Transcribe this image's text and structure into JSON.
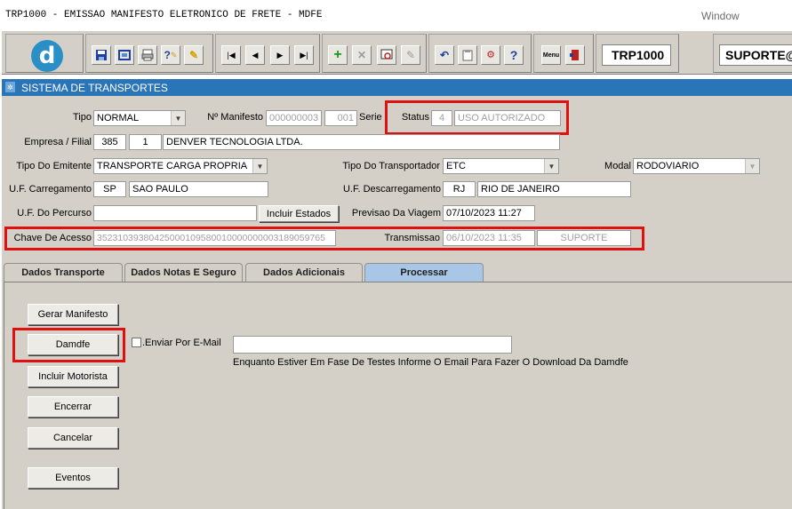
{
  "window": {
    "title": "TRP1000 - EMISSAO MANIFESTO ELETRONICO DE FRETE - MDFE",
    "menu": "Window"
  },
  "toolbar": {
    "logo_letter": "d",
    "buttons": [
      "save-icon",
      "preview-icon",
      "print-icon",
      "query-icon",
      "execute-icon",
      "first-icon",
      "previous-icon",
      "next-icon",
      "last-icon",
      "insert-icon",
      "delete-icon",
      "search-icon",
      "clear-icon",
      "undo-icon",
      "paste-icon",
      "settings-icon",
      "help-icon",
      "menu-icon",
      "exit-icon"
    ],
    "menu_label": "Menu",
    "program_code": "TRP1000",
    "user": "SUPORTE@"
  },
  "section": {
    "title": "SISTEMA DE TRANSPORTES"
  },
  "form": {
    "tipo_label": "Tipo",
    "tipo_value": "NORMAL",
    "manifesto_label": "Nº Manifesto",
    "manifesto_value": "000000003",
    "serie_number": "001",
    "serie_label": "Serie",
    "status_label": "Status",
    "status_code": "4",
    "status_desc": "USO AUTORIZADO",
    "empresa_label": "Empresa / Filial",
    "empresa_code": "385",
    "filial_code": "1",
    "empresa_name": "DENVER TECNOLOGIA LTDA.",
    "emitente_label": "Tipo Do Emitente",
    "emitente_value": "TRANSPORTE CARGA PROPRIA",
    "transportador_label": "Tipo Do Transportador",
    "transportador_value": "ETC",
    "modal_label": "Modal",
    "modal_value": "RODOVIARIO",
    "uf_carreg_label": "U.F. Carregamento",
    "uf_carreg_code": "SP",
    "uf_carreg_name": "SAO PAULO",
    "uf_descarreg_label": "U.F.  Descarregamento",
    "uf_descarreg_code": "RJ",
    "uf_descarreg_name": "RIO DE JANEIRO",
    "uf_percurso_label": "U.F. Do Percurso",
    "uf_percurso_value": "",
    "incluir_estados_label": "Incluir Estados",
    "previsao_label": "Previsao Da Viagem",
    "previsao_value": "07/10/2023 11:27",
    "chave_label": "Chave De Acesso",
    "chave_value": "35231039380425000109580010000000003189059765",
    "transmissao_label": "Transmissao",
    "transmissao_date": "06/10/2023 11:35",
    "transmissao_user": "SUPORTE"
  },
  "tabs": [
    {
      "label": "Dados Transporte"
    },
    {
      "label": "Dados Notas E Seguro"
    },
    {
      "label": "Dados Adicionais"
    },
    {
      "label": "Processar"
    }
  ],
  "processar": {
    "gerar_label": "Gerar Manifesto",
    "damdfe_label": "Damdfe",
    "enviar_email_label": ".Enviar Por E-Mail",
    "email_value": "",
    "email_hint": "Enquanto Estiver Em Fase De Testes Informe O Email Para Fazer O Download Da Damdfe",
    "incluir_motorista_label": "Incluir Motorista",
    "encerrar_label": "Encerrar",
    "cancelar_label": "Cancelar",
    "eventos_label": "Eventos"
  },
  "colors": {
    "highlight": "#e01010",
    "header": "#2a74b8",
    "active_tab": "#a8c7e6"
  }
}
